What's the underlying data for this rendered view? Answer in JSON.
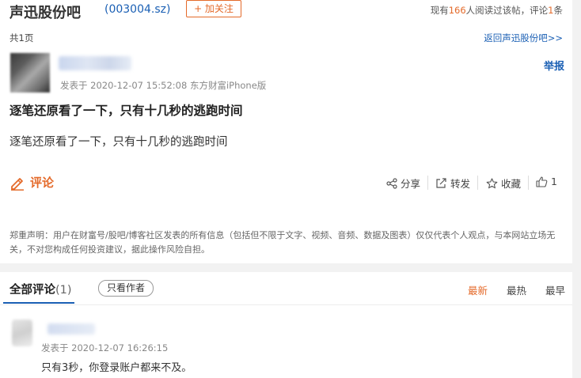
{
  "header": {
    "bar_name": "声迅股份吧",
    "stock_code": "(003004.sz)",
    "follow_label": "+ 加关注",
    "stats_prefix": "现有",
    "read_count": "166",
    "stats_middle": "人阅读过该帖，评论",
    "comment_count": "1",
    "stats_suffix": "条"
  },
  "pagination": {
    "pages_text": "共1页",
    "back_link": "返回声迅股份吧>>"
  },
  "post": {
    "meta": "发表于 2020-12-07 15:52:08 东方财富iPhone版",
    "report_label": "举报",
    "title": "逐笔还原看了一下，只有十几秒的逃跑时间",
    "body": "逐笔还原看了一下，只有十几秒的逃跑时间"
  },
  "actions": {
    "comment_label": "评论",
    "share_label": "分享",
    "forward_label": "转发",
    "favorite_label": "收藏",
    "like_count": "1"
  },
  "disclaimer": "郑重声明：用户在财富号/股吧/博客社区发表的所有信息（包括但不限于文字、视频、音频、数据及图表）仅仅代表个人观点，与本网站立场无关，不对您构成任何投资建议，据此操作风险自担。",
  "comments": {
    "tab_label": "全部评论",
    "tab_count": "(1)",
    "only_author_label": "只看作者",
    "sort_options": [
      "最新",
      "最热",
      "最早"
    ],
    "items": [
      {
        "meta": "发表于 2020-12-07 16:26:15",
        "text": "只有3秒，你登录账户都来不及。"
      }
    ]
  },
  "colors": {
    "accent": "#e46a2a",
    "link": "#1a5fb4",
    "background": "#f2f2f2"
  }
}
